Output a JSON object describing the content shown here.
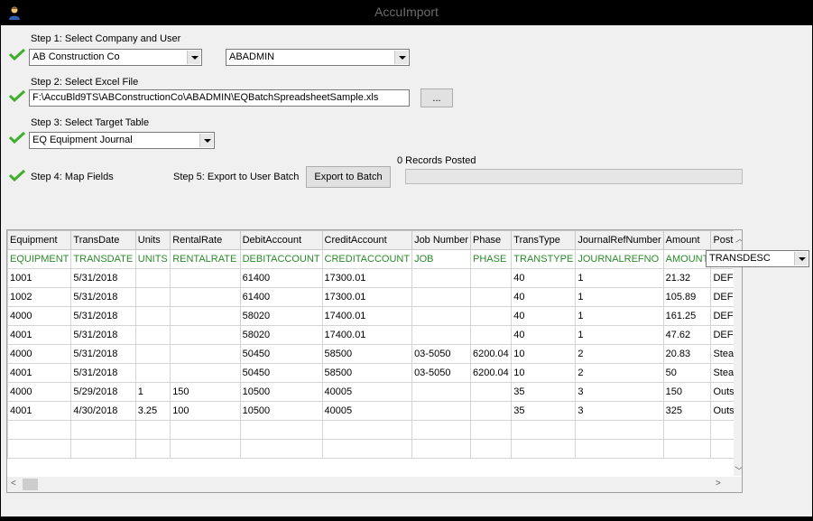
{
  "window": {
    "title": "AccuImport"
  },
  "colors": {
    "check": "#3fae2a",
    "mapping_text": "#2a8a2a"
  },
  "step1": {
    "label": "Step 1:  Select  Company and User",
    "company": "AB Construction Co",
    "user": "ABADMIN"
  },
  "step2": {
    "label": "Step 2:  Select Excel File",
    "file_path": "F:\\AccuBld9TS\\ABConstructionCo\\ABADMIN\\EQBatchSpreadsheetSample.xls",
    "browse_label": "..."
  },
  "step3": {
    "label": "Step 3:  Select Target Table",
    "table": "EQ Equipment Journal"
  },
  "step4": {
    "label": "Step 4:  Map Fields"
  },
  "step5": {
    "label": "Step 5:  Export to User Batch",
    "export_button": "Export to Batch",
    "records_posted": "0 Records Posted",
    "progress": 0
  },
  "grid": {
    "headers": [
      "Equipment",
      "TransDate",
      "Units",
      "RentalRate",
      "DebitAccount",
      "CreditAccount",
      "Job Number",
      "Phase",
      "TransType",
      "JournalRefNumber",
      "Amount",
      "Post"
    ],
    "mapping": [
      "EQUIPMENT",
      "TRANSDATE",
      "UNITS",
      "RENTALRATE",
      "DEBITACCOUNT",
      "CREDITACCOUNT",
      "JOB",
      "PHASE",
      "TRANSTYPE",
      "JOURNALREFNO",
      "AMOUNT",
      ""
    ],
    "rows": [
      [
        "1001",
        "5/31/2018",
        "",
        "",
        "61400",
        "17300.01",
        "",
        "",
        "40",
        "1",
        "21.32",
        "DEF"
      ],
      [
        "1002",
        "5/31/2018",
        "",
        "",
        "61400",
        "17300.01",
        "",
        "",
        "40",
        "1",
        "105.89",
        "DEF"
      ],
      [
        "4000",
        "5/31/2018",
        "",
        "",
        "58020",
        "17400.01",
        "",
        "",
        "40",
        "1",
        "161.25",
        "DEF"
      ],
      [
        "4001",
        "5/31/2018",
        "",
        "",
        "58020",
        "17400.01",
        "",
        "",
        "40",
        "1",
        "47.62",
        "DEF"
      ],
      [
        "4000",
        "5/31/2018",
        "",
        "",
        "50450",
        "58500",
        "03-5050",
        "6200.04",
        "10",
        "2",
        "20.83",
        "Stea"
      ],
      [
        "4001",
        "5/31/2018",
        "",
        "",
        "50450",
        "58500",
        "03-5050",
        "6200.04",
        "10",
        "2",
        "50",
        "Stea"
      ],
      [
        "4000",
        "5/29/2018",
        "1",
        "150",
        "10500",
        "40005",
        "",
        "",
        "35",
        "3",
        "150",
        "Outs"
      ],
      [
        "4001",
        "4/30/2018",
        "3.25",
        "100",
        "10500",
        "40005",
        "",
        "",
        "35",
        "3",
        "325",
        "Outs"
      ],
      [
        "",
        "",
        "",
        "",
        "",
        "",
        "",
        "",
        "",
        "",
        "",
        ""
      ],
      [
        "",
        "",
        "",
        "",
        "",
        "",
        "",
        "",
        "",
        "",
        "",
        ""
      ]
    ],
    "active_mapping_dropdown": "TRANSDESC"
  }
}
